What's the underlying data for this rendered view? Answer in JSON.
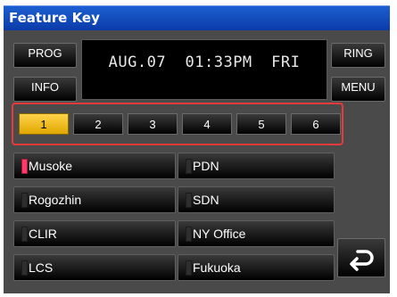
{
  "window": {
    "title": "Feature Key"
  },
  "buttons": {
    "prog": "PROG",
    "info": "INFO",
    "ring": "RING",
    "menu": "MENU"
  },
  "display": {
    "datetime": "AUG.07  01:33PM  FRI"
  },
  "pages": [
    {
      "label": "1",
      "active": true
    },
    {
      "label": "2",
      "active": false
    },
    {
      "label": "3",
      "active": false
    },
    {
      "label": "4",
      "active": false
    },
    {
      "label": "5",
      "active": false
    },
    {
      "label": "6",
      "active": false
    }
  ],
  "keys": {
    "left": [
      {
        "label": "Musoke",
        "led": "on"
      },
      {
        "label": "Rogozhin",
        "led": "off"
      },
      {
        "label": "CLIR",
        "led": "off"
      },
      {
        "label": "LCS",
        "led": "off"
      }
    ],
    "right": [
      {
        "label": "PDN",
        "led": "off"
      },
      {
        "label": "SDN",
        "led": "off"
      },
      {
        "label": "NY Office",
        "led": "off"
      },
      {
        "label": "Fukuoka",
        "led": "off"
      }
    ]
  },
  "colors": {
    "titlebar": "#0a3aa8",
    "active_page": "#ffc20e",
    "led_on": "#ff3b6a",
    "highlight": "#e83a3a"
  },
  "icons": {
    "back": "return-arrow-icon"
  }
}
